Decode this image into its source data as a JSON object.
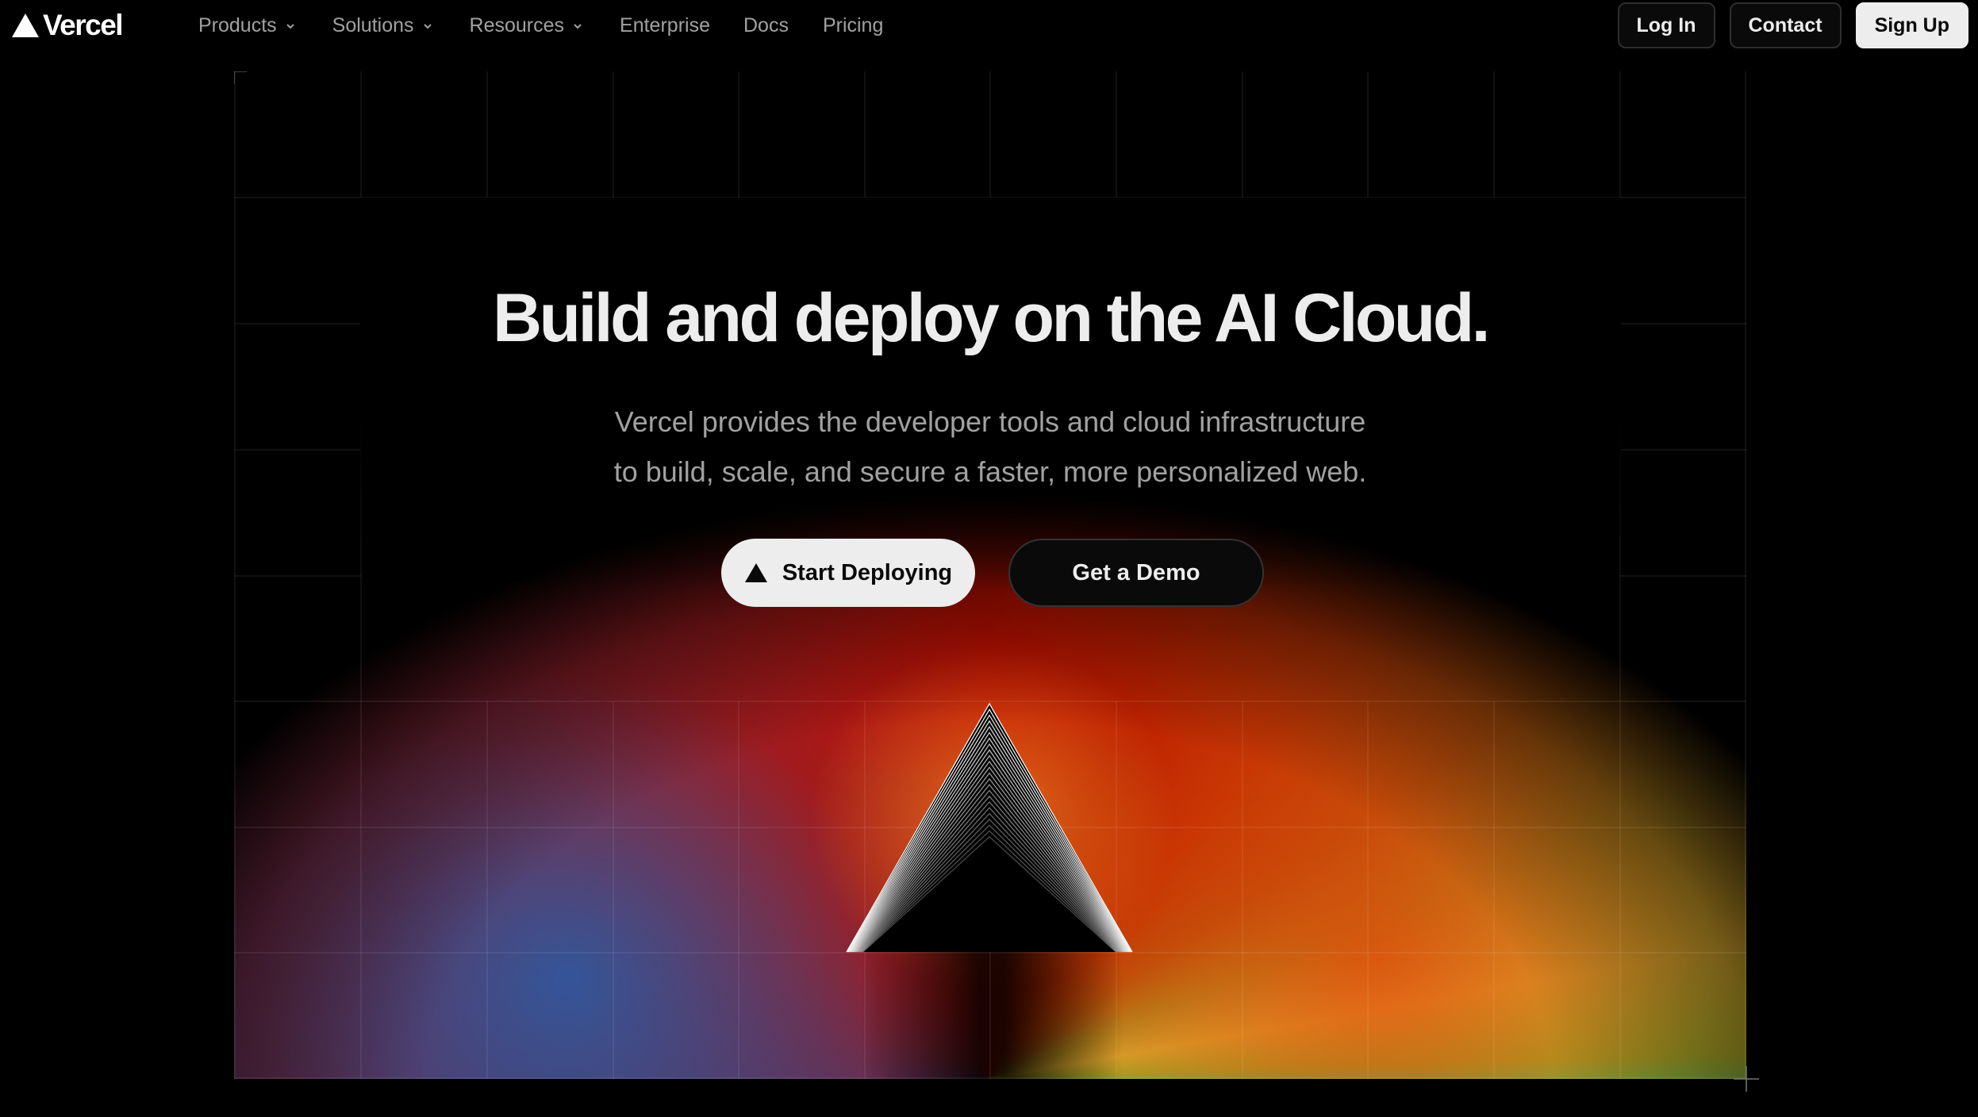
{
  "brand": {
    "name": "Vercel",
    "logo_icon": "vercel-triangle-icon"
  },
  "nav": {
    "items": [
      {
        "label": "Products",
        "has_dropdown": true
      },
      {
        "label": "Solutions",
        "has_dropdown": true
      },
      {
        "label": "Resources",
        "has_dropdown": true
      },
      {
        "label": "Enterprise",
        "has_dropdown": false
      },
      {
        "label": "Docs",
        "has_dropdown": false
      },
      {
        "label": "Pricing",
        "has_dropdown": false
      }
    ],
    "login_label": "Log In",
    "contact_label": "Contact",
    "signup_label": "Sign Up"
  },
  "hero": {
    "title": "Build and deploy on the AI Cloud.",
    "subtitle_line1": "Vercel provides the developer tools and cloud infrastructure",
    "subtitle_line2": "to build, scale, and secure a faster, more personalized web.",
    "primary_cta": "Start Deploying",
    "primary_cta_icon": "vercel-triangle-icon",
    "secondary_cta": "Get a Demo"
  },
  "colors": {
    "background": "#000000",
    "text_primary": "#ededed",
    "text_secondary": "#a1a1a1",
    "glow_green": "#16c47a",
    "glow_yellow": "#d4a52b",
    "glow_orange": "#c23a05",
    "glow_red": "#c30f00",
    "glow_blue": "#0651a6"
  }
}
